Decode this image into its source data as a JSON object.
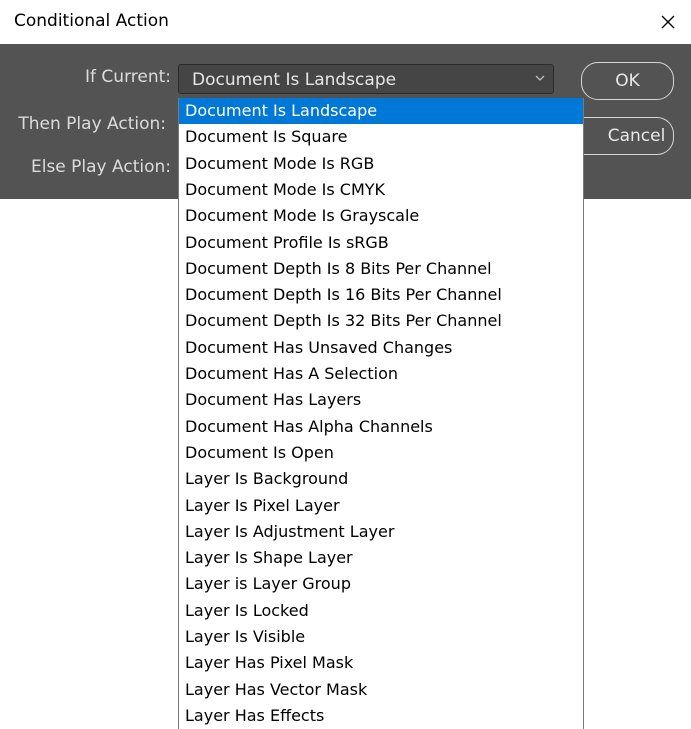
{
  "window": {
    "title": "Conditional Action",
    "close_icon": "close-icon"
  },
  "form": {
    "if_current_label": "If Current:",
    "then_label": "Then Play Action:",
    "else_label": "Else Play Action:",
    "selected_value": "Document Is Landscape"
  },
  "buttons": {
    "ok": "OK",
    "cancel": "Cancel"
  },
  "dropdown": {
    "selected_index": 0,
    "options": [
      "Document Is Landscape",
      "Document Is Square",
      "Document Mode Is RGB",
      "Document Mode Is CMYK",
      "Document Mode Is Grayscale",
      "Document Profile Is sRGB",
      "Document Depth Is 8 Bits Per Channel",
      "Document Depth Is 16 Bits Per Channel",
      "Document Depth Is 32 Bits Per Channel",
      "Document Has Unsaved Changes",
      "Document Has A Selection",
      "Document Has Layers",
      "Document Has Alpha Channels",
      "Document Is Open",
      "Layer Is Background",
      "Layer Is Pixel Layer",
      "Layer Is Adjustment Layer",
      "Layer Is Shape Layer",
      "Layer is Layer Group",
      "Layer Is Locked",
      "Layer Is Visible",
      "Layer Has Pixel Mask",
      "Layer Has Vector Mask",
      "Layer Has Effects"
    ]
  },
  "colors": {
    "dialog_bg": "#535353",
    "selection": "#0078d7"
  }
}
